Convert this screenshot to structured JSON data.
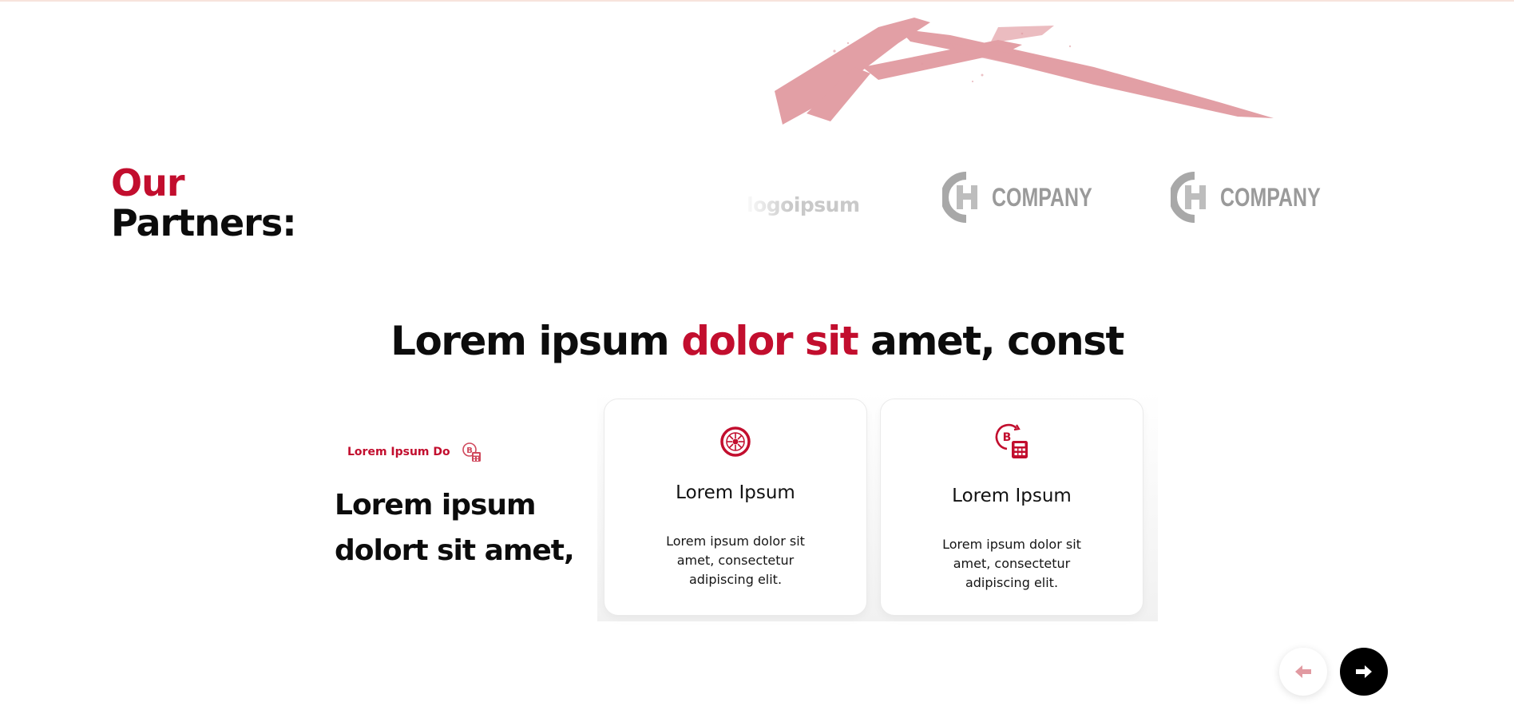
{
  "colors": {
    "accent": "#c20e2e",
    "accent_soft": "#e19aa1",
    "text_dark": "#0c0c0c",
    "logo_gray": "#9a9a9a"
  },
  "partners": {
    "title_accent": "Our",
    "title_rest": "Partners:",
    "logos": [
      {
        "type": "wordmark",
        "text": "logoipsum"
      },
      {
        "type": "company",
        "text": "COMPANY",
        "icon": "company-logo-icon"
      },
      {
        "type": "company",
        "text": "COMPANY",
        "icon": "company-logo-icon"
      }
    ]
  },
  "section": {
    "heading_before": "Lorem ipsum ",
    "heading_accent": "dolor sit",
    "heading_after": " amet, const",
    "tag": "Lorem Ipsum Do",
    "tag_icon": "bitcoin-calculator-icon",
    "left_heading": "Lorem ipsum dolort sit amet,"
  },
  "cards": [
    {
      "icon": "wheel-icon",
      "title": "Lorem Ipsum",
      "text": "Lorem ipsum dolor sit amet, consectetur adipiscing elit."
    },
    {
      "icon": "bitcoin-calculator-icon",
      "title": "Lorem Ipsum",
      "text": "Lorem ipsum dolor sit amet, consectetur adipiscing elit."
    }
  ],
  "nav": {
    "prev_icon": "arrow-left-icon",
    "next_icon": "arrow-right-icon"
  }
}
